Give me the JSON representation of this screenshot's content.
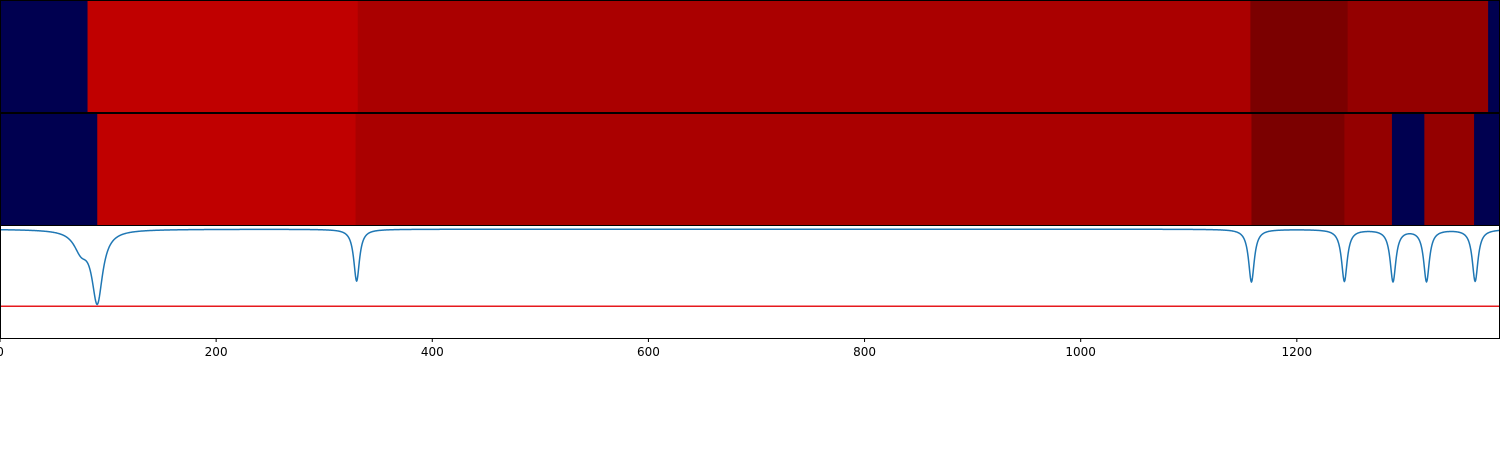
{
  "chart_data": [
    {
      "type": "heatmap",
      "title": "",
      "segments": [
        {
          "x0": 0,
          "x1": 81,
          "color": "#000050"
        },
        {
          "x0": 81,
          "x1": 331,
          "color": "#c00000"
        },
        {
          "x0": 331,
          "x1": 1157,
          "color": "#aa0000"
        },
        {
          "x0": 1157,
          "x1": 1247,
          "color": "#7b0000"
        },
        {
          "x0": 1247,
          "x1": 1377,
          "color": "#940000"
        },
        {
          "x0": 1377,
          "x1": 1388,
          "color": "#000050"
        }
      ]
    },
    {
      "type": "heatmap",
      "title": "",
      "segments": [
        {
          "x0": 0,
          "x1": 90,
          "color": "#000050"
        },
        {
          "x0": 90,
          "x1": 329,
          "color": "#c00000"
        },
        {
          "x0": 329,
          "x1": 1158,
          "color": "#aa0000"
        },
        {
          "x0": 1158,
          "x1": 1244,
          "color": "#7b0000"
        },
        {
          "x0": 1244,
          "x1": 1288,
          "color": "#940000"
        },
        {
          "x0": 1288,
          "x1": 1318,
          "color": "#000050"
        },
        {
          "x0": 1318,
          "x1": 1364,
          "color": "#940000"
        },
        {
          "x0": 1364,
          "x1": 1388,
          "color": "#000050"
        }
      ]
    },
    {
      "type": "line",
      "title": "",
      "xlabel": "",
      "ylabel": "",
      "xlim": [
        0,
        1388
      ],
      "ylim": [
        -1.3,
        0.05
      ],
      "xticks": [
        0,
        200,
        400,
        600,
        800,
        1000,
        1200
      ],
      "grid": false,
      "threshold": {
        "y": -0.92,
        "color": "#e6191d"
      },
      "series": [
        {
          "color": "#1f77b4",
          "baseline": 0,
          "dips": [
            {
              "center": 75,
              "depth": 0.22,
              "width": 8
            },
            {
              "center": 90,
              "depth": 0.85,
              "width": 6
            },
            {
              "center": 330,
              "depth": 0.62,
              "width": 3.2
            },
            {
              "center": 1158,
              "depth": 0.63,
              "width": 3.2
            },
            {
              "center": 1244,
              "depth": 0.62,
              "width": 3.2
            },
            {
              "center": 1289,
              "depth": 0.62,
              "width": 3.2
            },
            {
              "center": 1320,
              "depth": 0.62,
              "width": 3.2
            },
            {
              "center": 1365,
              "depth": 0.62,
              "width": 3.2
            }
          ]
        }
      ]
    }
  ]
}
